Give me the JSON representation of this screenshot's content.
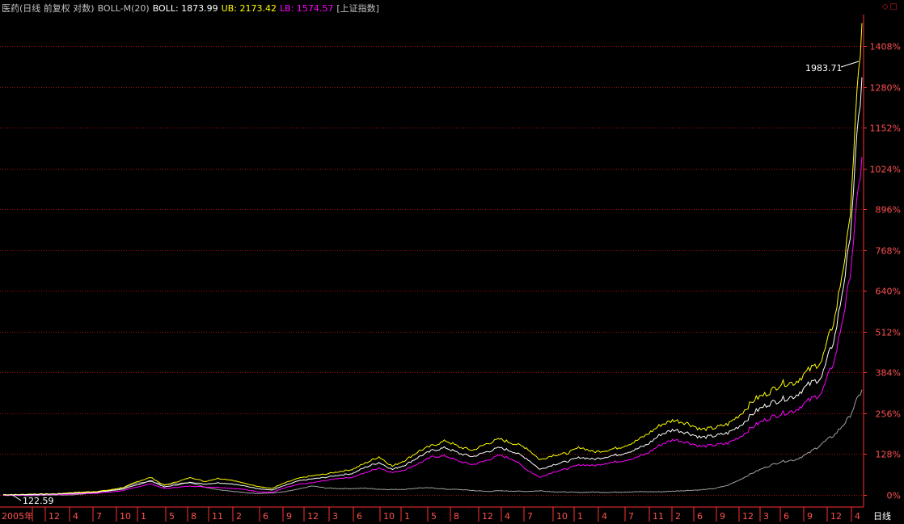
{
  "header": {
    "title": "医药(日线 前复权 对数)",
    "indicator": "BOLL-M(20)",
    "boll": "BOLL: 1873.99",
    "ub": "UB: 2173.42",
    "lb": "LB: 1574.57",
    "compare": "[上证指数]"
  },
  "window_controls": {
    "restore_icon": "◇",
    "maximize_icon": "□"
  },
  "period_label": "日线",
  "colors": {
    "ub": "#ffff00",
    "lb": "#ff00ff",
    "mid": "#ffffff",
    "compare": "#a0a0a0",
    "grid": "#a01010",
    "axis": "#ff3030",
    "tick": "#ff5050"
  },
  "chart_data": {
    "type": "line",
    "title": "医药(日线 前复权 对数)",
    "y_scale": "log",
    "y_ticks": [
      "1408%",
      "1280%",
      "1152%",
      "1024%",
      "896%",
      "768%",
      "640%",
      "512%",
      "384%",
      "256%",
      "128%",
      "0%"
    ],
    "y_tick_values": [
      1408,
      1280,
      1152,
      1024,
      896,
      768,
      640,
      512,
      384,
      256,
      128,
      0
    ],
    "x_ticks": [
      "2005年",
      "12",
      "4",
      "7",
      "10",
      "1",
      "5",
      "8",
      "11",
      "2",
      "6",
      "9",
      "12",
      "3",
      "6",
      "10",
      "1",
      "5",
      "8",
      "12",
      "4",
      "7",
      "10",
      "1",
      "4",
      "7",
      "11",
      "2",
      "6",
      "9",
      "12",
      "3",
      "6",
      "9",
      "12",
      "4"
    ],
    "annotations": [
      {
        "text": "1983.71",
        "type": "high_marker"
      },
      {
        "text": "122.59",
        "type": "low_marker"
      }
    ],
    "series": [
      {
        "name": "UB",
        "color": "#ffff00",
        "values": [
          1.2,
          1.0,
          2.5,
          3.0,
          3.5,
          7,
          9,
          11,
          16,
          24,
          42,
          55,
          30,
          42,
          55,
          42,
          52,
          47,
          36,
          27,
          20,
          38,
          52,
          60,
          65,
          73,
          80,
          100,
          120,
          90,
          110,
          138,
          155,
          170,
          150,
          140,
          160,
          175,
          162,
          148,
          110,
          125,
          130,
          150,
          135,
          140,
          150,
          165,
          190,
          220,
          235,
          225,
          205,
          210,
          222,
          255,
          300,
          320,
          350,
          352,
          390,
          420,
          560,
          820,
          1480
        ]
      },
      {
        "name": "BOLL",
        "color": "#ffffff",
        "values": [
          0,
          0,
          1.5,
          2.0,
          2.8,
          5,
          6,
          9,
          13,
          19,
          32,
          45,
          25,
          32,
          40,
          34,
          38,
          35,
          28,
          20,
          15,
          30,
          44,
          50,
          55,
          62,
          67,
          87,
          102,
          80,
          95,
          120,
          140,
          148,
          130,
          120,
          135,
          148,
          136,
          115,
          80,
          95,
          105,
          118,
          112,
          120,
          128,
          140,
          158,
          190,
          205,
          195,
          180,
          185,
          194,
          220,
          260,
          285,
          300,
          310,
          345,
          370,
          500,
          760,
          1310
        ]
      },
      {
        "name": "LB",
        "color": "#ff00ff",
        "values": [
          -1,
          -1.5,
          0,
          1.0,
          1.5,
          3,
          4,
          6,
          9,
          14,
          25,
          35,
          20,
          24,
          28,
          25,
          24,
          21,
          17,
          10,
          8,
          22,
          33,
          38,
          45,
          52,
          55,
          70,
          85,
          70,
          80,
          100,
          120,
          122,
          105,
          95,
          108,
          124,
          112,
          80,
          55,
          72,
          82,
          95,
          92,
          100,
          106,
          115,
          130,
          158,
          174,
          165,
          152,
          156,
          162,
          185,
          218,
          240,
          255,
          265,
          295,
          320,
          430,
          650,
          1060
        ]
      },
      {
        "name": "上证指数",
        "color": "#a0a0a0",
        "values": [
          0,
          -1,
          -2,
          -1,
          0,
          0,
          3,
          8,
          15,
          22,
          38,
          42,
          32,
          36,
          38,
          25,
          17,
          12,
          7,
          5,
          6,
          10,
          18,
          28,
          22,
          20,
          20,
          21,
          18,
          17,
          18,
          22,
          22,
          18,
          17,
          14,
          11,
          13,
          12,
          11,
          13,
          10,
          9,
          8,
          9,
          8,
          9,
          10,
          10,
          10,
          12,
          14,
          16,
          20,
          30,
          50,
          72,
          90,
          105,
          110,
          130,
          160,
          190,
          240,
          330
        ]
      }
    ]
  }
}
